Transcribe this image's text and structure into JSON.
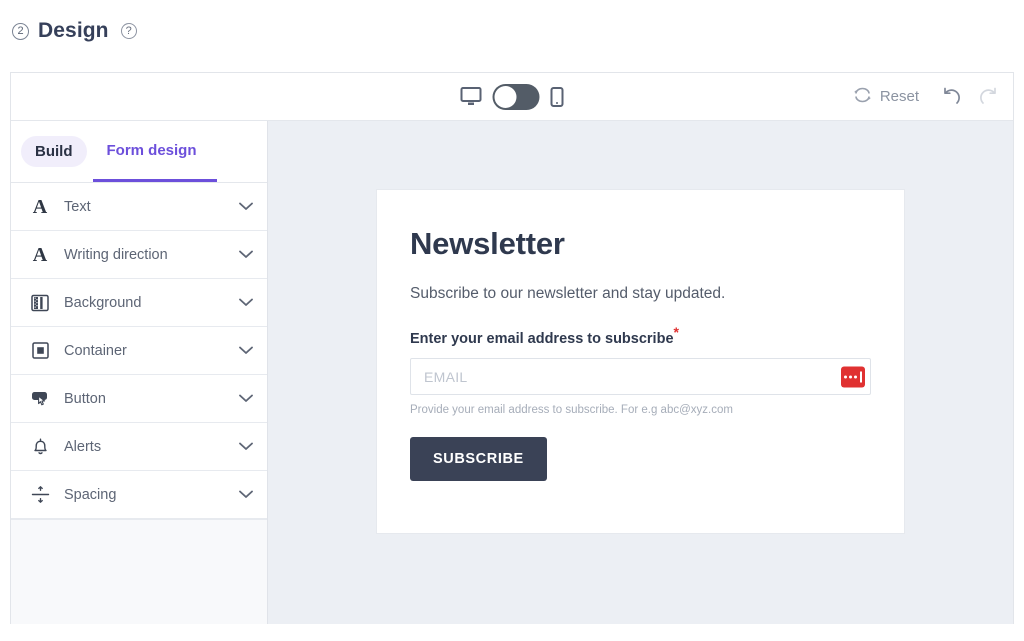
{
  "header": {
    "step_number": "2",
    "title": "Design",
    "help_icon": "help-circle-icon"
  },
  "toolbar": {
    "desktop_icon": "desktop-monitor-icon",
    "mobile_icon": "mobile-phone-icon",
    "toggle_state": "desktop",
    "reset_label": "Reset",
    "reset_icon": "reset-loop-icon",
    "undo_icon": "undo-arrow-icon",
    "redo_icon": "redo-arrow-icon"
  },
  "sidebar": {
    "tabs": [
      {
        "label": "Build",
        "active": false
      },
      {
        "label": "Form design",
        "active": true
      }
    ],
    "items": [
      {
        "label": "Text",
        "icon": "serif-a-icon"
      },
      {
        "label": "Writing direction",
        "icon": "serif-a-icon"
      },
      {
        "label": "Background",
        "icon": "background-pattern-icon"
      },
      {
        "label": "Container",
        "icon": "container-square-icon"
      },
      {
        "label": "Button",
        "icon": "button-cursor-icon"
      },
      {
        "label": "Alerts",
        "icon": "bell-icon"
      },
      {
        "label": "Spacing",
        "icon": "spacing-divide-icon"
      }
    ]
  },
  "form_preview": {
    "title": "Newsletter",
    "subtitle": "Subscribe to our newsletter and stay updated.",
    "field_label": "Enter your email address to subscribe",
    "required_marker": "*",
    "email_value": "",
    "email_placeholder": "EMAIL",
    "helper_text": "Provide your email address to subscribe. For e.g abc@xyz.com",
    "submit_label": "SUBSCRIBE",
    "validation_badge_icon": "validation-dots-icon"
  },
  "colors": {
    "accent_purple": "#6c4fdb",
    "button_dark": "#3a4256",
    "badge_red": "#e03131",
    "canvas_bg": "#eceff4"
  }
}
